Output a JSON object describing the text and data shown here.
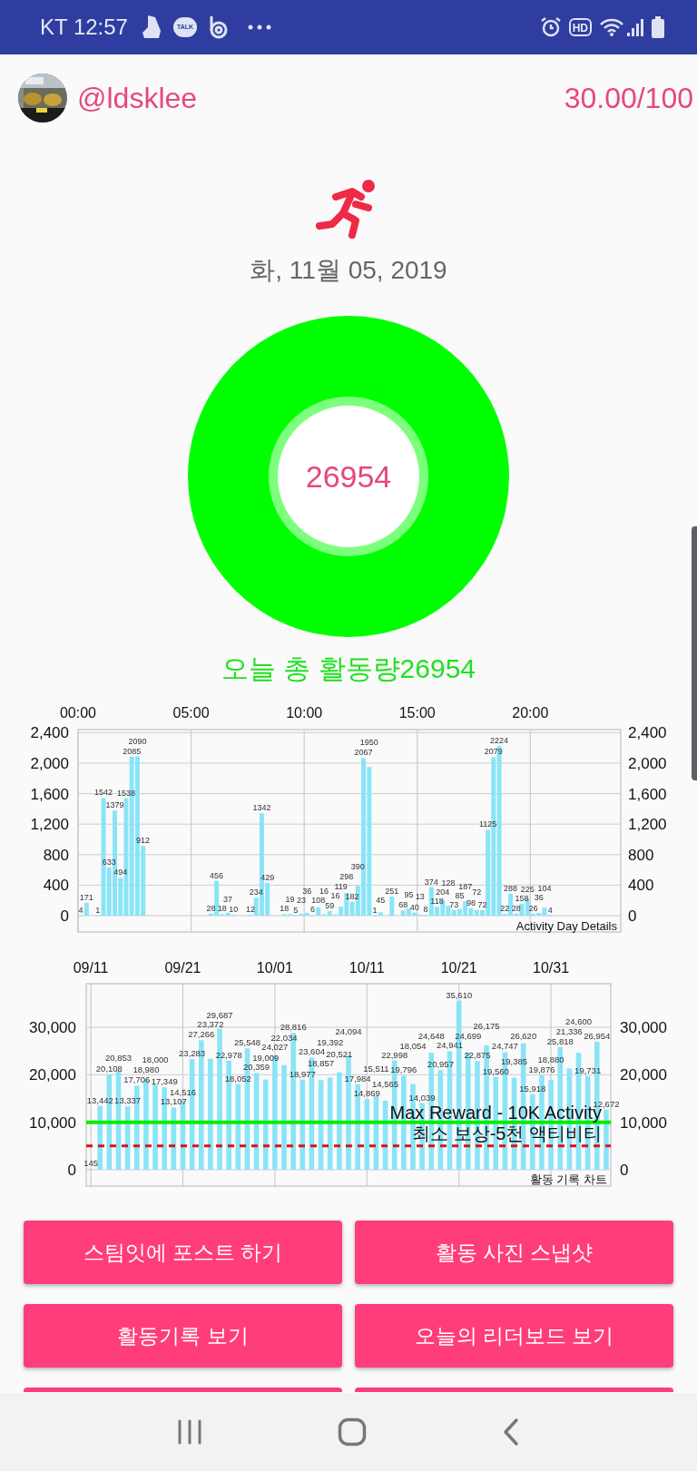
{
  "status_bar": {
    "carrier_time": "KT 12:57",
    "talk_badge": "TALK",
    "hd_badge": "HD"
  },
  "profile": {
    "username": "@ldsklee",
    "score": "30.00/100"
  },
  "date": "화, 11월 05, 2019",
  "ring": {
    "count": "26954"
  },
  "total_label": "오늘 총 활동량26954",
  "day_chart": {
    "chart_data": {
      "type": "bar",
      "title": "Activity Day Details",
      "grid": true,
      "xlim": [
        0,
        24
      ],
      "ylim": [
        0,
        2440
      ],
      "xticks": [
        {
          "value": 0,
          "label": "00:00"
        },
        {
          "value": 5,
          "label": "05:00"
        },
        {
          "value": 10,
          "label": "10:00"
        },
        {
          "value": 15,
          "label": "15:00"
        },
        {
          "value": 20,
          "label": "20:00"
        }
      ],
      "yticks": [
        {
          "value": 0,
          "label": "0"
        },
        {
          "value": 400,
          "label": "400"
        },
        {
          "value": 800,
          "label": "800"
        },
        {
          "value": 1200,
          "label": "1,200"
        },
        {
          "value": 1600,
          "label": "1,600"
        },
        {
          "value": 2000,
          "label": "2,000"
        },
        {
          "value": 2400,
          "label": "2,400"
        }
      ],
      "x": [
        0.125,
        0.375,
        0.875,
        1.125,
        1.375,
        1.625,
        1.875,
        2.125,
        2.375,
        2.625,
        2.875,
        5.875,
        6.125,
        6.375,
        6.625,
        6.875,
        7.625,
        7.875,
        8.125,
        8.375,
        9.125,
        9.375,
        9.625,
        9.875,
        10.125,
        10.375,
        10.625,
        10.875,
        11.125,
        11.375,
        11.625,
        11.875,
        12.125,
        12.375,
        12.625,
        12.875,
        13.125,
        13.375,
        13.875,
        14.375,
        14.625,
        14.875,
        15.125,
        15.375,
        15.625,
        15.875,
        16.125,
        16.375,
        16.625,
        16.875,
        17.125,
        17.375,
        17.625,
        17.875,
        18.125,
        18.375,
        18.625,
        18.875,
        19.125,
        19.375,
        19.625,
        19.875,
        20.125,
        20.375,
        20.625,
        20.875
      ],
      "series": [
        {
          "color": "#8ae4f8",
          "values": [
            4,
            171,
            1,
            1542,
            633,
            1379,
            494,
            1538,
            2085,
            2090,
            912,
            28,
            456,
            18,
            37,
            10,
            12,
            234,
            1342,
            429,
            18,
            19,
            5,
            23,
            36,
            6,
            108,
            16,
            59,
            16,
            119,
            298,
            182,
            390,
            2067,
            1950,
            1,
            45,
            251,
            68,
            95,
            40,
            13,
            8,
            374,
            118,
            204,
            128,
            73,
            85,
            187,
            98,
            72,
            72,
            1125,
            2079,
            2224,
            22,
            288,
            28,
            158,
            225,
            26,
            36,
            104,
            4
          ]
        }
      ],
      "data_labels": true
    }
  },
  "history_chart": {
    "chart_data": {
      "type": "bar",
      "title": "활동 기록 차트",
      "grid": true,
      "ylim": [
        0,
        39171
      ],
      "categories": [
        "09/11",
        null,
        null,
        null,
        null,
        null,
        null,
        null,
        null,
        null,
        "09/21",
        null,
        null,
        null,
        null,
        null,
        null,
        null,
        null,
        null,
        "10/01",
        null,
        null,
        null,
        null,
        null,
        null,
        null,
        null,
        null,
        "10/11",
        null,
        null,
        null,
        null,
        null,
        null,
        null,
        null,
        null,
        "10/21",
        null,
        null,
        null,
        null,
        null,
        null,
        null,
        null,
        null,
        "10/31",
        null,
        null,
        null,
        null,
        null,
        null
      ],
      "yticks": [
        {
          "value": 0,
          "label": "0"
        },
        {
          "value": 10000,
          "label": "10,000"
        },
        {
          "value": 20000,
          "label": "20,000"
        },
        {
          "value": 30000,
          "label": "30,000"
        }
      ],
      "series": [
        {
          "color": "#8ae4f8",
          "values": [
            145,
            13442,
            20108,
            20853,
            13337,
            17706,
            18980,
            18000,
            17349,
            13107,
            14516,
            23283,
            27266,
            23372,
            29687,
            22978,
            18052,
            25548,
            20359,
            19009,
            24027,
            22034,
            28816,
            18977,
            23604,
            18857,
            19392,
            20521,
            24094,
            17984,
            14869,
            15511,
            14565,
            22998,
            19796,
            18054,
            14039,
            24648,
            20957,
            24941,
            35610,
            24699,
            22875,
            26175,
            19560,
            24747,
            19385,
            26620,
            15918,
            19876,
            18880,
            25818,
            21336,
            24600,
            19731,
            26954,
            12672
          ]
        }
      ],
      "value_labels": [
        "145",
        "13,442",
        "20,108",
        "20,853",
        "13,337",
        "17,706",
        "18,980",
        "18,000",
        "17,349",
        "13,107",
        "14,516",
        "23,283",
        "27,266",
        "23,372",
        "29,687",
        "22,978",
        "18,052",
        "25,548",
        "20,359",
        "19,009",
        "24,027",
        "22,034",
        "28,816",
        "18,977",
        "23,604",
        "18,857",
        "19,392",
        "20,521",
        "24,094",
        "17,984",
        "14,869",
        "15,511",
        "14,565",
        "22,998",
        "19,796",
        "18,054",
        "14,039",
        "24,648",
        "20,957",
        "24,941",
        "35,610",
        "24,699",
        "22,875",
        "26,175",
        "19,560",
        "24,747",
        "19,385",
        "26,620",
        "15,918",
        "19,876",
        "18,880",
        "25,818",
        "21,336",
        "24,600",
        "19,731",
        "26,954",
        "12,672"
      ],
      "ref_lines": [
        {
          "axis": "y",
          "value": 10000,
          "label": "Max Reward - 10K Activity",
          "color": "#00ee00"
        },
        {
          "axis": "y",
          "value": 5000,
          "label": "최소 보상-5천 액티비티",
          "color": "#dd1111"
        }
      ]
    }
  },
  "buttons": [
    "스팀잇에 포스트 하기",
    "활동 사진 스냅샷",
    "활동기록 보기",
    "오늘의 리더보드 보기"
  ]
}
